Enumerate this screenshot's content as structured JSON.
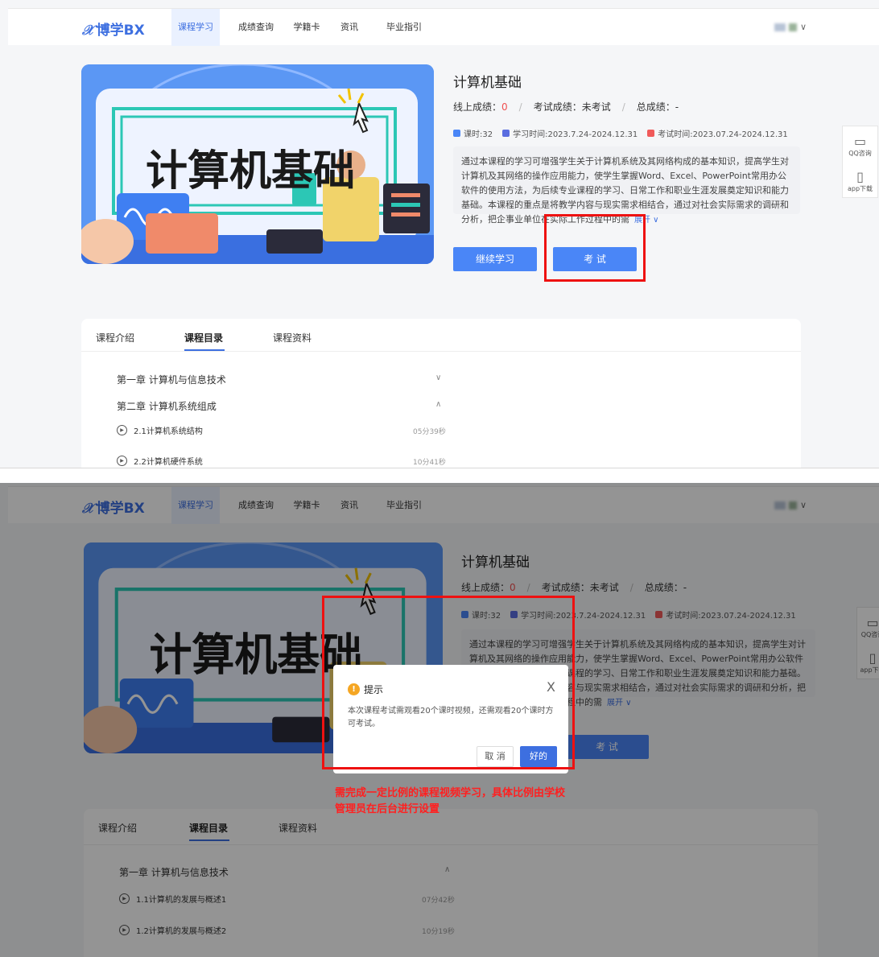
{
  "nav": {
    "logo": "博学BX",
    "logo_mark": "𝒳",
    "items": [
      "课程学习",
      "成绩查询",
      "学籍卡",
      "资讯",
      "毕业指引"
    ],
    "active_index": 0,
    "chevron": "∨"
  },
  "banner": {
    "text": "计算机基础"
  },
  "course": {
    "title": "计算机基础",
    "online_score_label": "线上成绩：",
    "online_score_value": "0",
    "exam_score_label": "考试成绩：",
    "exam_score_value": "未考试",
    "total_score_label": "总成绩：",
    "total_score_value": "-",
    "hours": "课时:32",
    "study_time": "学习时间:2023.7.24-2024.12.31",
    "exam_time": "考试时间:2023.07.24-2024.12.31",
    "description": "通过本课程的学习可增强学生关于计算机系统及其网络构成的基本知识，提高学生对计算机及其网络的操作应用能力，使学生掌握Word、Excel、PowerPoint常用办公软件的使用方法，为后续专业课程的学习、日常工作和职业生涯发展奠定知识和能力基础。本课程的重点是将教学内容与现实需求相结合，通过对社会实际需求的调研和分析，把企事业单位在实际工作过程中的需",
    "expand": "展开 ∨",
    "continue_btn": "继续学习",
    "exam_btn": "考 试"
  },
  "side": {
    "qq": "QQ咨询",
    "app": "app下载",
    "qq_icon": "message-square-icon",
    "app_icon": "tablet-icon"
  },
  "tabs": [
    "课程介绍",
    "课程目录",
    "课程资料"
  ],
  "active_tab": 1,
  "panel1_catalog": {
    "ch1": "第一章 计算机与信息技术",
    "ch2": "第二章 计算机系统组成",
    "lessons": [
      {
        "name": "2.1计算机系统结构",
        "duration": "05分39秒"
      },
      {
        "name": "2.2计算机硬件系统",
        "duration": "10分41秒"
      }
    ]
  },
  "panel2_catalog": {
    "ch1": "第一章 计算机与信息技术",
    "lessons": [
      {
        "name": "1.1计算机的发展与概述1",
        "duration": "07分42秒"
      },
      {
        "name": "1.2计算机的发展与概述2",
        "duration": "10分19秒"
      }
    ]
  },
  "modal": {
    "title": "提示",
    "icon": "!",
    "body": "本次课程考试需观看20个课时视频，还需观看20个课时方可考试。",
    "cancel": "取 消",
    "ok": "好的",
    "close": "X"
  },
  "annotation": "需完成一定比例的课程视频学习，具体比例由学校管理员在后台进行设置",
  "colors": {
    "accent": "#3d6fe0",
    "button": "#4a86f7",
    "highlight": "#ee1111"
  }
}
